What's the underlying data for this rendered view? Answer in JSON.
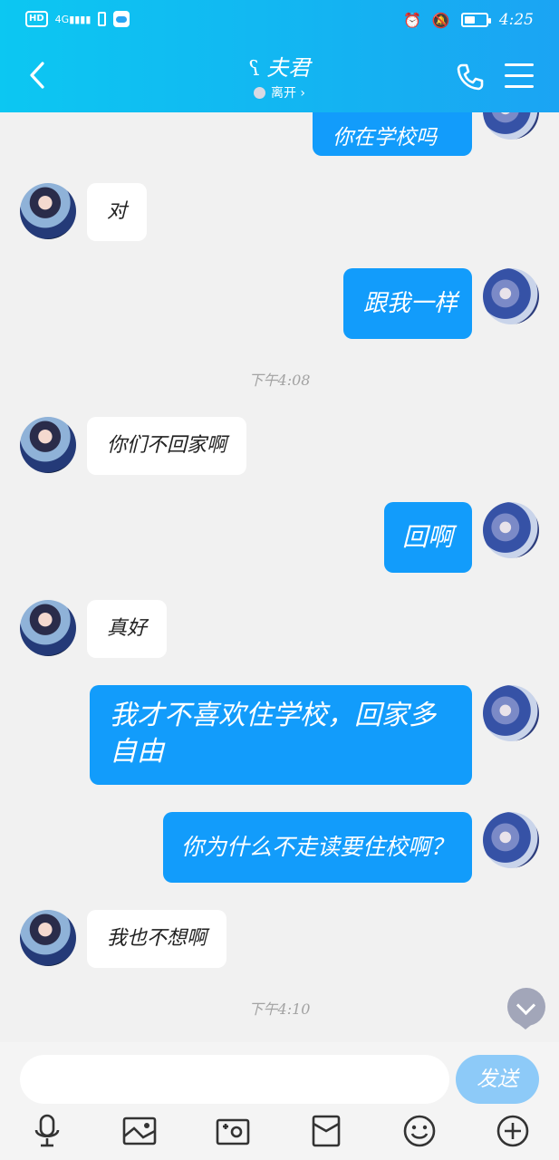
{
  "status_bar": {
    "hd": "HD",
    "network": "4G",
    "time": "4:25"
  },
  "header": {
    "title": "夫君",
    "status": "离开",
    "status_chevron": "›",
    "back_icon": "chevron-left-icon"
  },
  "messages": [
    {
      "side": "out",
      "text": "你在学校吗"
    },
    {
      "side": "in",
      "text": "对"
    },
    {
      "side": "out",
      "text": "跟我一样"
    },
    {
      "side": "time",
      "text": "下午4:08"
    },
    {
      "side": "in",
      "text": "你们不回家啊"
    },
    {
      "side": "out",
      "text": "回啊"
    },
    {
      "side": "in",
      "text": "真好"
    },
    {
      "side": "out",
      "text": "我才不喜欢住学校，回家多自由"
    },
    {
      "side": "out",
      "text": "你为什么不走读要住校啊？"
    },
    {
      "side": "in",
      "text": "我也不想啊"
    },
    {
      "side": "time",
      "text": "下午4:10"
    }
  ],
  "input": {
    "placeholder": "",
    "value": "",
    "send_label": "发送"
  },
  "toolbar": {
    "icons": [
      "microphone-icon",
      "image-icon",
      "camera-icon",
      "red-packet-icon",
      "emoji-icon",
      "plus-icon"
    ]
  },
  "colors": {
    "header_start": "#0cc7f2",
    "header_end": "#1ba4f3",
    "outgoing_bubble": "#129cfb",
    "send_button": "#8dcaf8"
  }
}
